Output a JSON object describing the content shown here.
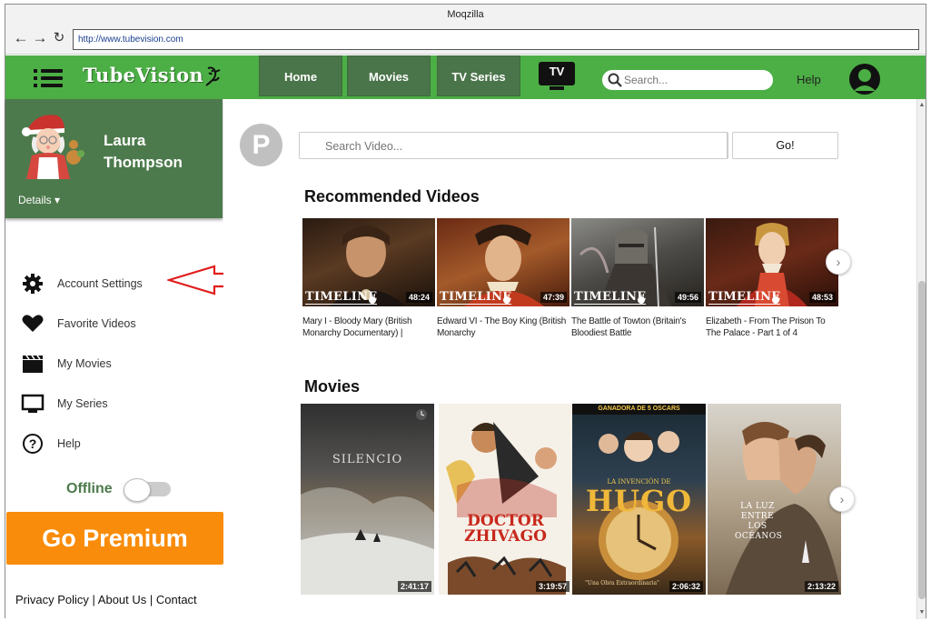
{
  "browser": {
    "title": "Moqzilla",
    "url": "http://www.tubevision.com"
  },
  "header": {
    "logo": "TubeVision",
    "nav": [
      "Home",
      "Movies",
      "TV Series"
    ],
    "tv_label": "TV",
    "search_placeholder": "Search...",
    "help": "Help"
  },
  "sidebar": {
    "user_name": "Laura Thompson",
    "details_label": "Details ▾",
    "menu": [
      {
        "label": "Account Settings",
        "icon": "gear-icon"
      },
      {
        "label": "Favorite Videos",
        "icon": "heart-icon"
      },
      {
        "label": "My Movies",
        "icon": "clapperboard-icon"
      },
      {
        "label": "My Series",
        "icon": "monitor-icon"
      },
      {
        "label": "Help",
        "icon": "question-icon"
      }
    ],
    "offline_label": "Offline",
    "offline_enabled": false,
    "premium_label": "Go Premium",
    "footer": "Privacy Policy | About Us | Contact"
  },
  "main": {
    "badge_letter": "P",
    "video_search_placeholder": "Search Video...",
    "go_label": "Go!",
    "recommended_title": "Recommended Videos",
    "recommended": [
      {
        "title": "Mary I - Bloody Mary (British Monarchy Documentary) |",
        "duration": "48:24",
        "badge": "TIMELINE"
      },
      {
        "title": "Edward VI - The Boy King (British Monarchy",
        "duration": "47:39",
        "badge": "TIMELINE"
      },
      {
        "title": "The Battle of Towton (Britain's Bloodiest Battle",
        "duration": "49:56",
        "badge": "TIMELINE"
      },
      {
        "title": "Elizabeth - From The Prison To The Palace - Part 1 of 4",
        "duration": "48:53",
        "badge": "TIMELINE"
      }
    ],
    "movies_title": "Movies",
    "movies": [
      {
        "poster_text": "SILENCIO",
        "duration": "2:41:17"
      },
      {
        "poster_text": "DOCTOR ZHIVAGO",
        "duration": "3:19:57"
      },
      {
        "poster_text": "HUGO",
        "duration": "2:06:32",
        "top_banner": "GANADORA DE 5 OSCARS",
        "tagline": "LA INVENCIÓN DE",
        "bottom_text": "\"Una Obra Extraordinaria\""
      },
      {
        "poster_text": "LA LUZ ENTRE LOS OCÉANOS",
        "duration": "2:13:22"
      }
    ]
  }
}
